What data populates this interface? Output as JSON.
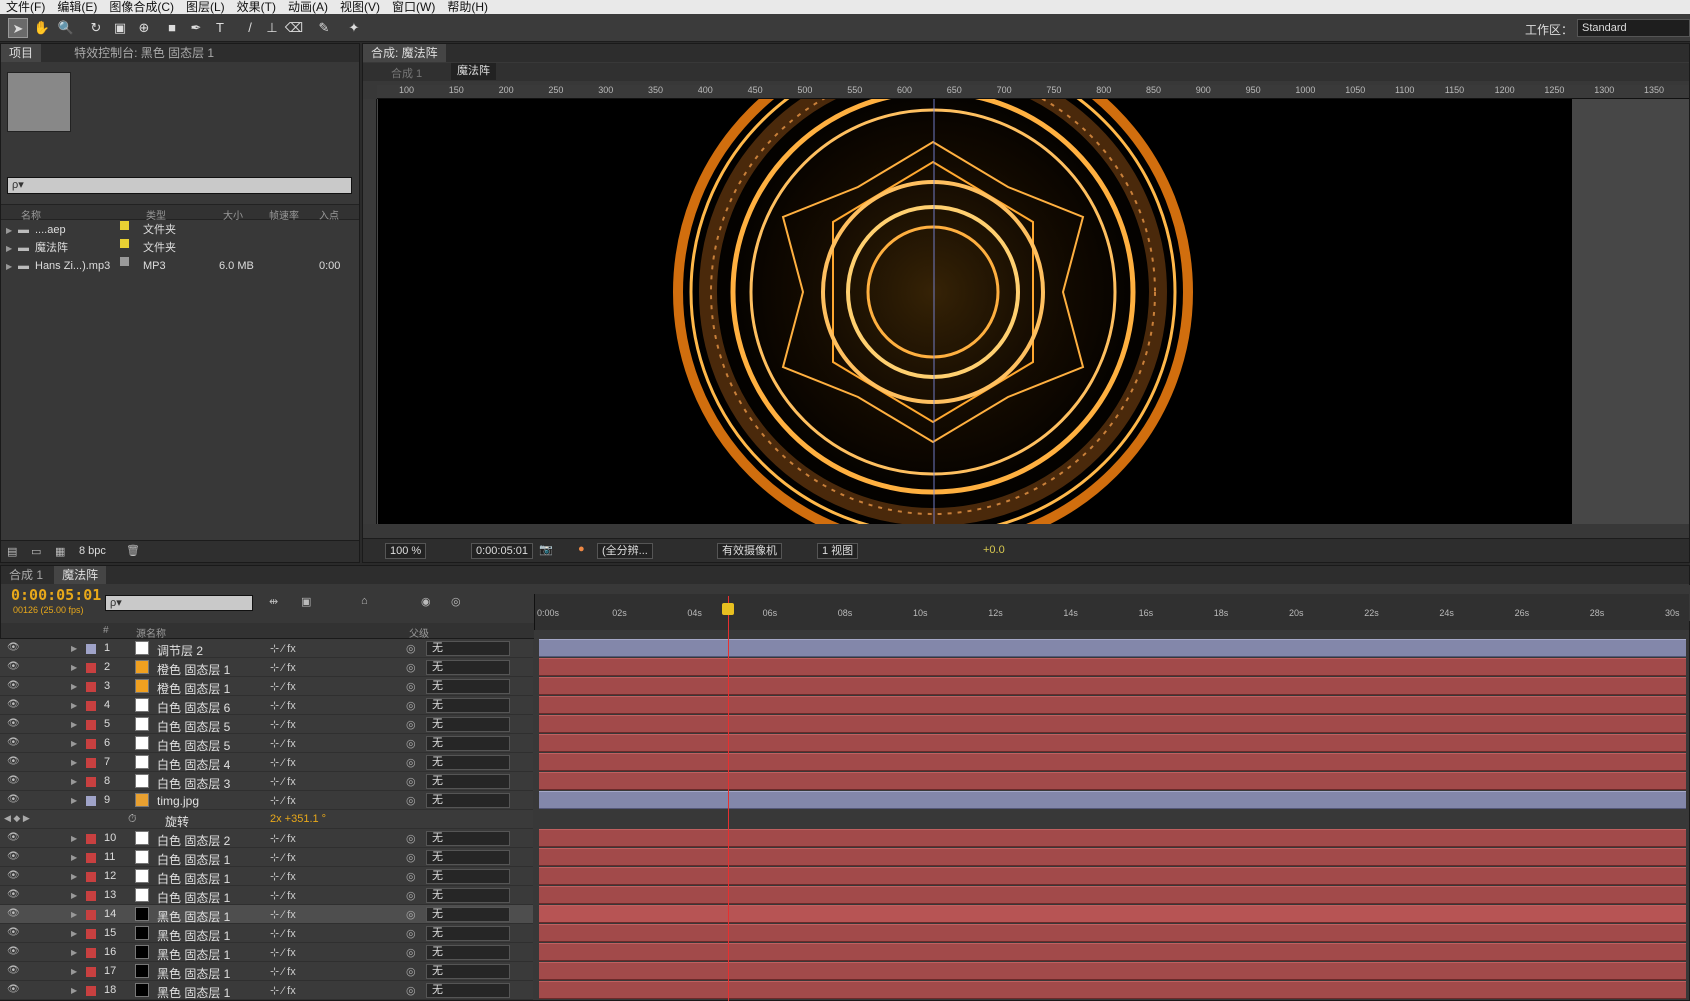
{
  "menu": [
    "文件(F)",
    "编辑(E)",
    "图像合成(C)",
    "图层(L)",
    "效果(T)",
    "动画(A)",
    "视图(V)",
    "窗口(W)",
    "帮助(H)"
  ],
  "workspace": {
    "label": "工作区：",
    "value": "Standard"
  },
  "project": {
    "tab_project": "项目",
    "tab_effects": "特效控制台: 黑色 固态层 1",
    "search_placeholder": "ρ▾",
    "columns": [
      "名称",
      "类型",
      "大小",
      "帧速率",
      "入点"
    ],
    "items": [
      {
        "name": "....aep",
        "type": "文件夹",
        "size": "",
        "in": "",
        "color": "#e8d033"
      },
      {
        "name": "魔法阵",
        "type": "文件夹",
        "size": "",
        "in": "",
        "color": "#e8d033"
      },
      {
        "name": "Hans Zi...).mp3",
        "type": "MP3",
        "size": "6.0 MB",
        "in": "0:00",
        "color": "#9a9a9a"
      }
    ],
    "bpc": "8 bpc"
  },
  "comp": {
    "tab": "合成: 魔法阵",
    "crumb_prev": "合成 1",
    "crumb_current": "魔法阵",
    "ruler_ticks": [
      "100",
      "150",
      "200",
      "250",
      "300",
      "350",
      "400",
      "450",
      "500",
      "550",
      "600",
      "650",
      "700",
      "750",
      "800",
      "850",
      "900",
      "950",
      "1000",
      "1050",
      "1100",
      "1150",
      "1200",
      "1250",
      "1300",
      "1350"
    ],
    "zoom": "100 %",
    "timecode": "0:00:05:01",
    "resolution": "(全分辨...",
    "camera": "有效摄像机",
    "views": "1 视图",
    "exposure": "+0.0"
  },
  "timeline": {
    "tab_comp1": "合成 1",
    "tab_magic": "魔法阵",
    "timecode": "0:00:05:01",
    "fps": "00126 (25.00 fps)",
    "search_placeholder": "ρ▾",
    "header": {
      "hash": "#",
      "source": "源名称",
      "parent": "父级"
    },
    "time_ticks": [
      "0:00s",
      "02s",
      "04s",
      "06s",
      "08s",
      "10s",
      "12s",
      "14s",
      "16s",
      "18s",
      "20s",
      "22s",
      "24s",
      "26s",
      "28s",
      "30s"
    ],
    "layers": [
      {
        "num": "1",
        "name": "调节层 2",
        "label": "#9fa3c8",
        "src": "#ffffff",
        "parent": "无",
        "bar": "blue"
      },
      {
        "num": "2",
        "name": "橙色 固态层 1",
        "label": "#c84040",
        "src": "#f0a020",
        "parent": "无",
        "bar": "red"
      },
      {
        "num": "3",
        "name": "橙色 固态层 1",
        "label": "#c84040",
        "src": "#f0a020",
        "parent": "无",
        "bar": "red"
      },
      {
        "num": "4",
        "name": "白色 固态层 6",
        "label": "#c84040",
        "src": "#ffffff",
        "parent": "无",
        "bar": "red"
      },
      {
        "num": "5",
        "name": "白色 固态层 5",
        "label": "#c84040",
        "src": "#ffffff",
        "parent": "无",
        "bar": "red"
      },
      {
        "num": "6",
        "name": "白色 固态层 5",
        "label": "#c84040",
        "src": "#ffffff",
        "parent": "无",
        "bar": "red"
      },
      {
        "num": "7",
        "name": "白色 固态层 4",
        "label": "#c84040",
        "src": "#ffffff",
        "parent": "无",
        "bar": "red"
      },
      {
        "num": "8",
        "name": "白色 固态层 3",
        "label": "#c84040",
        "src": "#ffffff",
        "parent": "无",
        "bar": "red"
      },
      {
        "num": "9",
        "name": "timg.jpg",
        "label": "#9fa3c8",
        "src": "#e8a030",
        "parent": "无",
        "bar": "blue"
      },
      {
        "num": "",
        "name": "旋转",
        "value": "2x +351.1 °",
        "prop": true
      },
      {
        "num": "10",
        "name": "白色 固态层 2",
        "label": "#c84040",
        "src": "#ffffff",
        "parent": "无",
        "bar": "red"
      },
      {
        "num": "11",
        "name": "白色 固态层 1",
        "label": "#c84040",
        "src": "#ffffff",
        "parent": "无",
        "bar": "red"
      },
      {
        "num": "12",
        "name": "白色 固态层 1",
        "label": "#c84040",
        "src": "#ffffff",
        "parent": "无",
        "bar": "red"
      },
      {
        "num": "13",
        "name": "白色 固态层 1",
        "label": "#c84040",
        "src": "#ffffff",
        "parent": "无",
        "bar": "red"
      },
      {
        "num": "14",
        "name": "黑色 固态层 1",
        "label": "#c84040",
        "src": "#000000",
        "parent": "无",
        "bar": "red",
        "selected": true
      },
      {
        "num": "15",
        "name": "黑色 固态层 1",
        "label": "#c84040",
        "src": "#000000",
        "parent": "无",
        "bar": "red"
      },
      {
        "num": "16",
        "name": "黑色 固态层 1",
        "label": "#c84040",
        "src": "#000000",
        "parent": "无",
        "bar": "red"
      },
      {
        "num": "17",
        "name": "黑色 固态层 1",
        "label": "#c84040",
        "src": "#000000",
        "parent": "无",
        "bar": "red"
      },
      {
        "num": "18",
        "name": "黑色 固态层 1",
        "label": "#c84040",
        "src": "#000000",
        "parent": "无",
        "bar": "red"
      }
    ]
  }
}
